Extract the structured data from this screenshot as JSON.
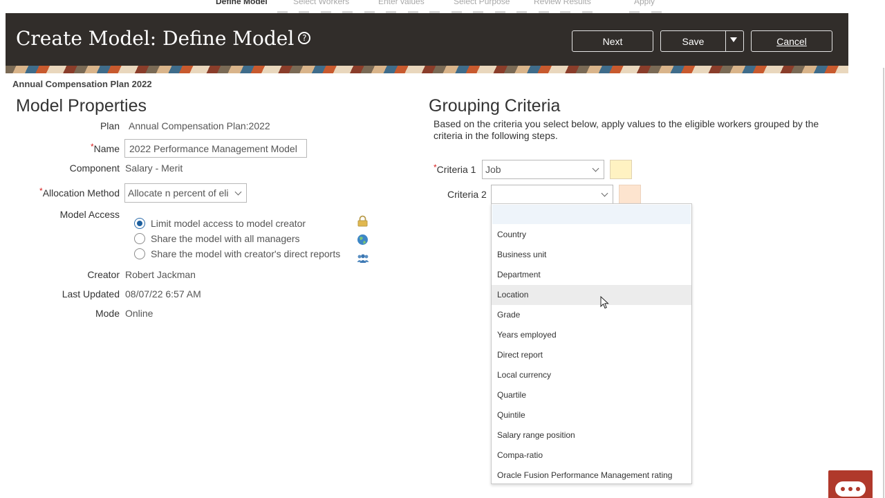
{
  "train": {
    "steps": [
      "Define Model",
      "Select Workers",
      "Enter values",
      "Select Purpose",
      "Review Results",
      "Apply"
    ]
  },
  "header": {
    "title": "Create Model: Define Model",
    "help_glyph": "?",
    "next_label": "Next",
    "save_label": "Save",
    "cancel_label": "Cancel"
  },
  "plan_heading": "Annual Compensation Plan 2022",
  "model_properties": {
    "title": "Model Properties",
    "plan_label": "Plan",
    "plan_value": "Annual Compensation Plan:2022",
    "required_mark": "*",
    "name_label": "Name",
    "name_value": "2022 Performance Management Model",
    "component_label": "Component",
    "component_value": "Salary - Merit",
    "allocation_label": "Allocation Method",
    "allocation_value": "Allocate n percent of eli",
    "access_label": "Model Access",
    "access_options": [
      {
        "label": "Limit model access to model creator",
        "icon": "lock-icon",
        "checked": true
      },
      {
        "label": "Share the model with all managers",
        "icon": "globe-icon",
        "checked": false
      },
      {
        "label": "Share the model with creator's direct reports",
        "icon": "people-icon",
        "checked": false
      }
    ],
    "creator_label": "Creator",
    "creator_value": "Robert Jackman",
    "updated_label": "Last Updated",
    "updated_value": "08/07/22 6:57 AM",
    "mode_label": "Mode",
    "mode_value": "Online"
  },
  "grouping": {
    "title": "Grouping Criteria",
    "description": "Based on the criteria you select below, apply values to the eligible workers grouped by the criteria in the following steps.",
    "criteria1_label": "Criteria 1",
    "criteria1_value": "Job",
    "criteria1_color": "#fff2c2",
    "criteria2_label": "Criteria 2",
    "criteria2_value": "",
    "criteria2_color": "#fde4cf",
    "dropdown_options": [
      "Country",
      "Business unit",
      "Department",
      "Location",
      "Grade",
      "Years employed",
      "Direct report",
      "Local currency",
      "Quartile",
      "Quintile",
      "Salary range position",
      "Compa-ratio",
      "Oracle Fusion Performance Management rating"
    ],
    "hovered_option": "Location"
  },
  "colors": {
    "header_bg": "#312d2a",
    "chat_button": "#b0392b",
    "radio_selected": "#1c5f9e"
  }
}
